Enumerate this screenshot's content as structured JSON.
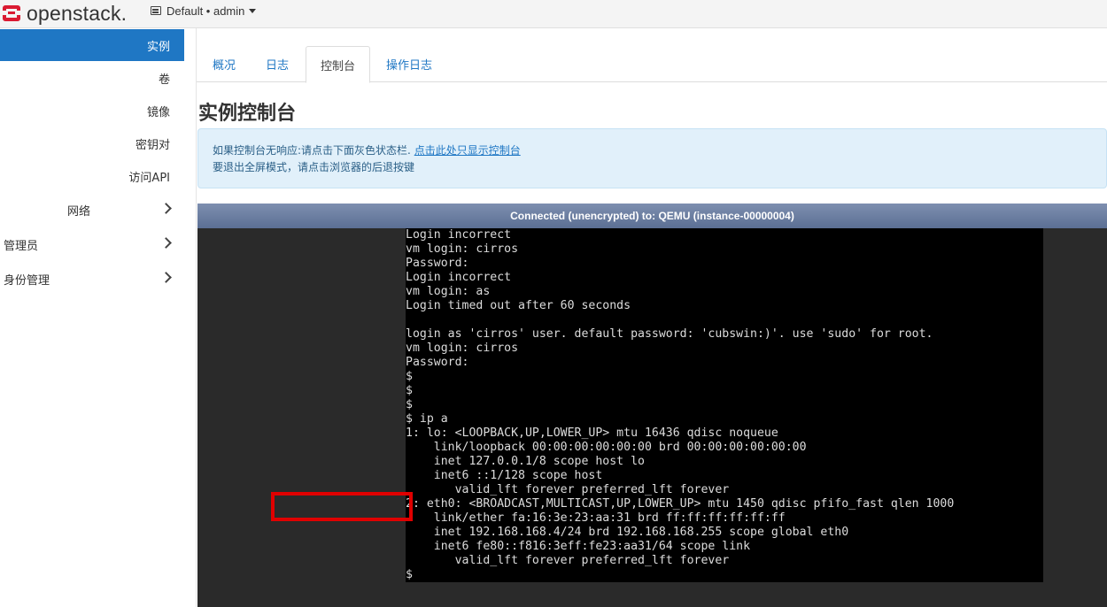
{
  "topbar": {
    "brand": "openstack",
    "brand_dot": ".",
    "project_label": "Default • admin"
  },
  "sidebar": {
    "items": [
      {
        "label": "实例",
        "active": true
      },
      {
        "label": "卷"
      },
      {
        "label": "镜像"
      },
      {
        "label": "密钥对"
      },
      {
        "label": "访问API"
      },
      {
        "label": "网络"
      },
      {
        "label": "管理员"
      },
      {
        "label": "身份管理"
      }
    ]
  },
  "tabs": [
    {
      "label": "概况"
    },
    {
      "label": "日志"
    },
    {
      "label": "控制台",
      "active": true
    },
    {
      "label": "操作日志"
    }
  ],
  "page_title": "实例控制台",
  "alert": {
    "line1_text": "如果控制台无响应:请点击下面灰色状态栏. ",
    "line1_link": "点击此处只显示控制台",
    "line2_text": "要退出全屏模式，请点击浏览器的后退按键"
  },
  "console": {
    "status_bar": "Connected (unencrypted) to: QEMU (instance-00000004)",
    "lines": [
      "Login incorrect",
      "vm login: cirros",
      "Password:",
      "Login incorrect",
      "vm login: as",
      "Login timed out after 60 seconds",
      "",
      "login as 'cirros' user. default password: 'cubswin:)'. use 'sudo' for root.",
      "vm login: cirros",
      "Password:",
      "$",
      "$",
      "$",
      "$ ip a",
      "1: lo: <LOOPBACK,UP,LOWER_UP> mtu 16436 qdisc noqueue",
      "    link/loopback 00:00:00:00:00:00 brd 00:00:00:00:00:00",
      "    inet 127.0.0.1/8 scope host lo",
      "    inet6 ::1/128 scope host",
      "       valid_lft forever preferred_lft forever",
      "2: eth0: <BROADCAST,MULTICAST,UP,LOWER_UP> mtu 1450 qdisc pfifo_fast qlen 1000",
      "    link/ether fa:16:3e:23:aa:31 brd ff:ff:ff:ff:ff:ff",
      "    inet 192.168.168.4/24 brd 192.168.168.255 scope global eth0",
      "    inet6 fe80::f816:3eff:fe23:aa31/64 scope link",
      "       valid_lft forever preferred_lft forever",
      "$"
    ],
    "highlighted_ip": "192.168.168.4/24",
    "highlight_color": "#e00000"
  }
}
